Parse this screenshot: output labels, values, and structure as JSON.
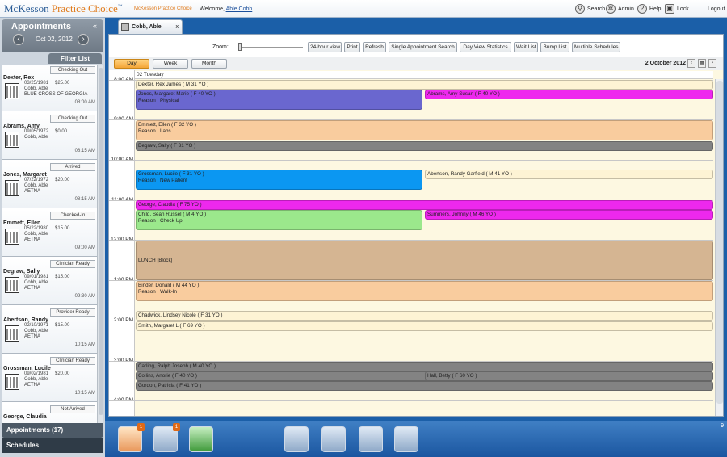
{
  "header": {
    "logo": "McKesson",
    "logo_product": "Practice Choice",
    "logo_tm": "™",
    "logo_sub": "McKesson Practice Choice",
    "welcome": "Welcome,",
    "user_name": "Able Cobb",
    "nav": {
      "search": "Search",
      "admin": "Admin",
      "help": "Help",
      "lock": "Lock",
      "logout": "Logout"
    }
  },
  "sidebar": {
    "title": "Appointments",
    "collapse": "«",
    "date": "Oct 02, 2012",
    "filter_label": "Filter List",
    "patients": [
      {
        "status": "Checking Out",
        "name": "Dexter, Rex",
        "dob": "03/25/1981",
        "amount": "$25.00",
        "provider": "Cobb, Able",
        "insurance": "BLUE CROSS OF GEORGIA",
        "time": "08:00 AM"
      },
      {
        "status": "Checking Out",
        "name": "Abrams, Amy",
        "dob": "09/05/1972",
        "amount": "$0.00",
        "provider": "Cobb, Able",
        "insurance": "",
        "time": "08:15 AM"
      },
      {
        "status": "Arrived",
        "name": "Jones, Margaret",
        "dob": "07/22/1972",
        "amount": "$20.00",
        "provider": "Cobb, Able",
        "insurance": "AETNA",
        "time": "08:15 AM"
      },
      {
        "status": "Checked-In",
        "name": "Emmett, Ellen",
        "dob": "05/22/1980",
        "amount": "$15.00",
        "provider": "Cobb, Able",
        "insurance": "AETNA",
        "time": "09:00 AM"
      },
      {
        "status": "Clinician Ready",
        "name": "Degraw, Sally",
        "dob": "09/01/1981",
        "amount": "$15.00",
        "provider": "Cobb, Able",
        "insurance": "AETNA",
        "time": "09:30 AM"
      },
      {
        "status": "Provider Ready",
        "name": "Abertson, Randy",
        "dob": "02/10/1971",
        "amount": "$15.00",
        "provider": "Cobb, Able",
        "insurance": "AETNA",
        "time": "10:15 AM"
      },
      {
        "status": "Clinician Ready",
        "name": "Grossman, Lucile",
        "dob": "09/02/1981",
        "amount": "$20.00",
        "provider": "Cobb, Able",
        "insurance": "AETNA",
        "time": "10:15 AM"
      },
      {
        "status": "Not Arrived",
        "name": "George, Claudia",
        "dob": "",
        "amount": "",
        "provider": "",
        "insurance": "",
        "time": ""
      }
    ],
    "footer_appointments": "Appointments (17)",
    "footer_schedules": "Schedules"
  },
  "tab": {
    "title": "Cobb, Able",
    "close": "x"
  },
  "toolbar": {
    "zoom_label": "Zoom:",
    "buttons": [
      "24-hour view",
      "Print",
      "Refresh",
      "Single Appointment Search",
      "Day View Statistics",
      "Wait List",
      "Bump List",
      "Multiple Schedules"
    ]
  },
  "viewbar": {
    "views": [
      "Day",
      "Week",
      "Month"
    ],
    "active_view": "Day",
    "current_date": "2 October 2012",
    "nav": [
      "‹",
      "▦",
      "›"
    ]
  },
  "schedule": {
    "day_label": "02 Tuesday",
    "hours": [
      "8:00 AM",
      "9:00 AM",
      "10:00 AM",
      "11:00 AM",
      "12:00 PM",
      "1:00 PM",
      "2:00 PM",
      "3:00 PM",
      "4:00 PM"
    ],
    "colors": {
      "purple": "#6a67cf",
      "magenta": "#ee28ee",
      "peach": "#f9cc9e",
      "gray": "#838383",
      "blue": "#0b97f2",
      "green": "#9be88c",
      "tan": "#d5b592",
      "cream": "#fdf3d4"
    },
    "appointments": [
      {
        "line1": "Dexter, Rex James ( M 31 YO )",
        "line2": "",
        "color": "cream"
      },
      {
        "line1": "Jones, Margaret Marie ( F 40 YO )",
        "line2": "Reason : Physical",
        "color": "purple"
      },
      {
        "line1": "Abrams, Amy Susan ( F 40 YO )",
        "line2": "",
        "color": "magenta"
      },
      {
        "line1": "Emmett, Ellen ( F 32 YO )",
        "line2": "Reason : Labs",
        "color": "peach"
      },
      {
        "line1": "Degraw, Sally ( F 31 YO )",
        "line2": "",
        "color": "gray"
      },
      {
        "line1": "Grossman, Lucile ( F 31 YO )",
        "line2": "Reason : New Patient",
        "color": "blue"
      },
      {
        "line1": "Abertson, Randy Garfield ( M 41 YO )",
        "line2": "",
        "color": "cream"
      },
      {
        "line1": "George, Claudia ( F 75 YO )",
        "line2": "",
        "color": "magenta"
      },
      {
        "line1": "Child, Sean Russel ( M 4 YO )",
        "line2": "Reason : Check Up",
        "color": "green"
      },
      {
        "line1": "Summers, Johnny ( M 46 YO )",
        "line2": "",
        "color": "magenta"
      },
      {
        "line1": "LUNCH  [Block]",
        "line2": "",
        "color": "tan"
      },
      {
        "line1": "Binder, Donald ( M 44 YO )",
        "line2": "Reason : Walk-In",
        "color": "peach"
      },
      {
        "line1": "Chadwick, Lindsey Nicole ( F 31 YO )",
        "line2": "",
        "color": "cream"
      },
      {
        "line1": "Smith, Margaret L ( F 69 YO )",
        "line2": "",
        "color": "cream"
      },
      {
        "line1": "Carling, Ralph Joseph ( M 40 YO )",
        "line2": "",
        "color": "gray"
      },
      {
        "line1": "Collins, Anorie ( F 40 YO )",
        "line2": "",
        "color": "gray"
      },
      {
        "line1": "Hall, Betty ( F 60 YO )",
        "line2": "",
        "color": "gray"
      },
      {
        "line1": "Gordon, Patricia ( F 41 YO )",
        "line2": "",
        "color": "gray"
      }
    ]
  },
  "bottombar": {
    "badges": [
      "1",
      "1"
    ],
    "icons": [
      "patient-icon",
      "calendar-icon",
      "calculator-icon",
      "mail-icon",
      "billing-icon",
      "ledger-icon",
      "users-icon"
    ],
    "pager": "9"
  }
}
